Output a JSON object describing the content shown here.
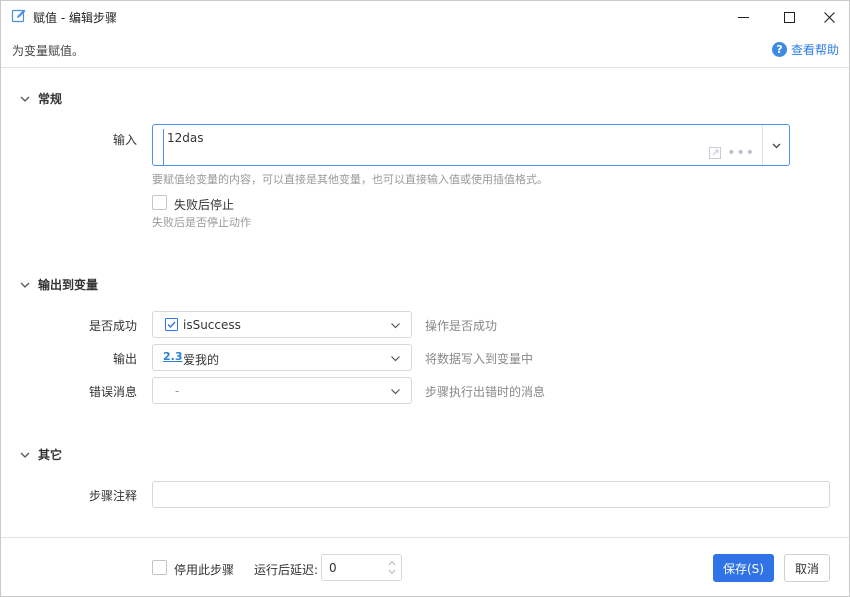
{
  "window": {
    "title": "赋值 - 编辑步骤",
    "subtitle": "为变量赋值。",
    "help_label": "查看帮助"
  },
  "sections": {
    "general": {
      "title": "常规",
      "input_label": "输入",
      "input_value": "12das",
      "input_hint": "要赋值给变量的内容，可以直接是其他变量，也可以直接输入值或使用插值格式。",
      "stop_on_fail_label": "失败后停止",
      "stop_on_fail_hint": "失败后是否停止动作",
      "stop_on_fail_checked": false
    },
    "output": {
      "title": "输出到变量",
      "success_label": "是否成功",
      "success_value": "isSuccess",
      "success_note": "操作是否成功",
      "output_label": "输出",
      "output_type_badge": "2.3",
      "output_value": "爱我的",
      "output_note": "将数据写入到变量中",
      "error_label": "错误消息",
      "error_value": "-",
      "error_note": "步骤执行出错时的消息"
    },
    "other": {
      "title": "其它",
      "note_label": "步骤注释",
      "note_value": ""
    }
  },
  "footer": {
    "disable_label": "停用此步骤",
    "disable_checked": false,
    "delay_label": "运行后延迟:",
    "delay_value": "0",
    "save_label": "保存(S)",
    "cancel_label": "取消"
  },
  "colors": {
    "accent": "#2f73e6",
    "focus_border": "#4e8ff0",
    "help_link": "#2f7ee0"
  },
  "icons": {
    "title": "edit-icon",
    "help": "question-circle-icon",
    "success_select": "checkbox-checked-icon",
    "output_select": "number-type-icon"
  }
}
